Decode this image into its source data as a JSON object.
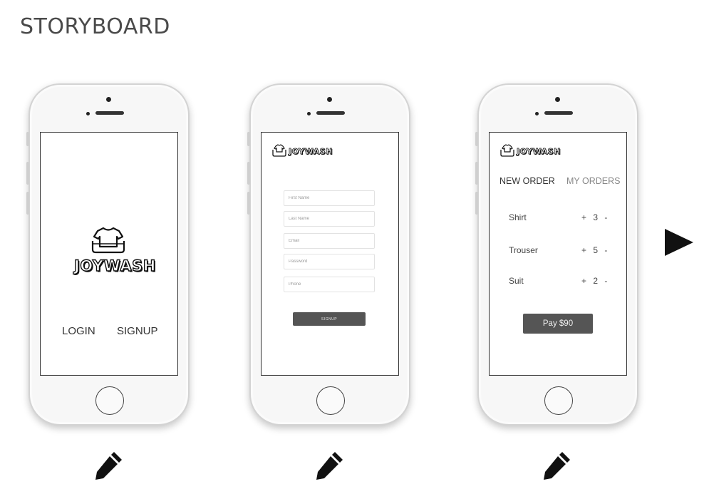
{
  "page": {
    "title": "STORYBOARD"
  },
  "brand": {
    "logo_text": "JOYWASH"
  },
  "screen1": {
    "login_label": "LOGIN",
    "signup_label": "SIGNUP"
  },
  "screen2": {
    "fields": [
      {
        "placeholder": "First Name"
      },
      {
        "placeholder": "Last Name"
      },
      {
        "placeholder": "Email"
      },
      {
        "placeholder": "Password"
      },
      {
        "placeholder": "Phone"
      }
    ],
    "submit_label": "SIGNUP"
  },
  "screen3": {
    "tabs": [
      {
        "label": "NEW ORDER"
      },
      {
        "label": "MY ORDERS"
      }
    ],
    "items": [
      {
        "name": "Shirt",
        "qty": "3"
      },
      {
        "name": "Trouser",
        "qty": "5"
      },
      {
        "name": "Suit",
        "qty": "2"
      }
    ],
    "plus_symbol": "+",
    "minus_symbol": "-",
    "pay_label": "Pay $90"
  },
  "icons": {
    "edit": "pencil-icon",
    "next": "play-icon",
    "logo": "tshirt-basket-icon"
  },
  "colors": {
    "button_bg": "#555555",
    "text": "#444444",
    "bezel": "#d3d3d3"
  }
}
